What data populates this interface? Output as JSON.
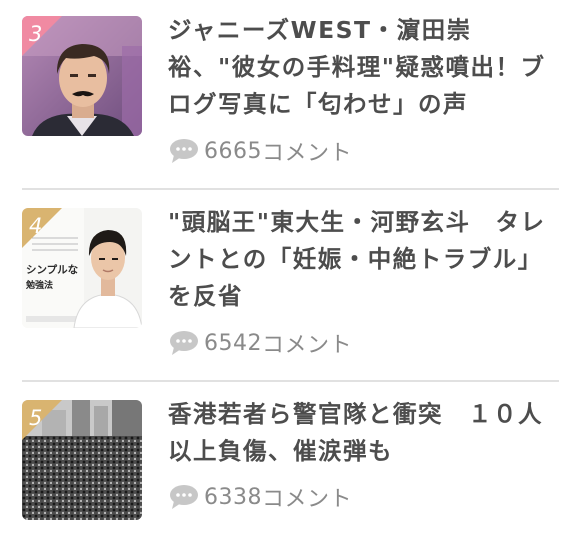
{
  "articles": [
    {
      "rank": "3",
      "title": "ジャニーズWEST・濵田崇裕、\"彼女の手料理\"疑惑噴出！ブログ写真に「匂わせ」の声",
      "comment_count": "6665",
      "comment_suffix": "コメント",
      "badge_color": "#f08aa2"
    },
    {
      "rank": "4",
      "title": "\"頭脳王\"東大生・河野玄斗　タレントとの「妊娠・中絶トラブル」を反省",
      "comment_count": "6542",
      "comment_suffix": "コメント",
      "badge_color": "#d9b470",
      "thumb_text": "シンプルな",
      "thumb_text2": "勉強法"
    },
    {
      "rank": "5",
      "title": "香港若者ら警官隊と衝突　１０人以上負傷、催涙弾も",
      "comment_count": "6338",
      "comment_suffix": "コメント",
      "badge_color": "#d9b470"
    }
  ],
  "icons": {
    "comment": "speech-bubble-icon"
  }
}
